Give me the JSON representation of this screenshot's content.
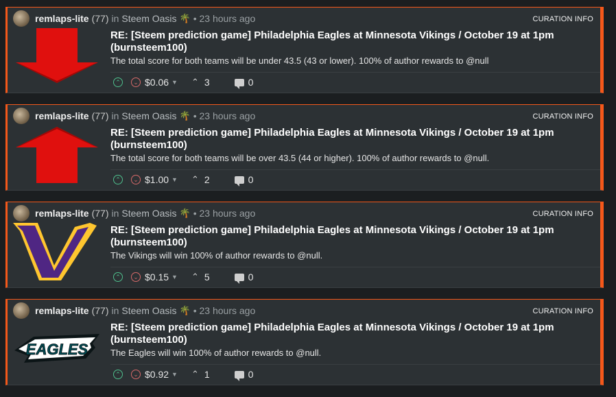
{
  "posts": [
    {
      "author": "remlaps-lite",
      "reputation": "(77)",
      "in_word": "in",
      "community": "Steem Oasis",
      "community_icon": "palm-tree-icon",
      "age": "• 23 hours ago",
      "curation_label": "CURATION INFO",
      "thumbnail": "red-down-arrow-thumbnail",
      "title": "RE: [Steem prediction game] Philadelphia Eagles at Minnesota Vikings / October 19 at 1pm (burnsteem100)",
      "body": "The total score for both teams will be under 43.5 (43 or lower). 100% of author rewards to @null",
      "payout": "$0.06",
      "voters": "3",
      "comments": "0"
    },
    {
      "author": "remlaps-lite",
      "reputation": "(77)",
      "in_word": "in",
      "community": "Steem Oasis",
      "community_icon": "palm-tree-icon",
      "age": "• 23 hours ago",
      "curation_label": "CURATION INFO",
      "thumbnail": "red-up-arrow-thumbnail",
      "title": "RE: [Steem prediction game] Philadelphia Eagles at Minnesota Vikings / October 19 at 1pm (burnsteem100)",
      "body": "The total score for both teams will be over 43.5 (44 or higher). 100% of author rewards to @null.",
      "payout": "$1.00",
      "voters": "2",
      "comments": "0"
    },
    {
      "author": "remlaps-lite",
      "reputation": "(77)",
      "in_word": "in",
      "community": "Steem Oasis",
      "community_icon": "palm-tree-icon",
      "age": "• 23 hours ago",
      "curation_label": "CURATION INFO",
      "thumbnail": "vikings-logo-thumbnail",
      "title": "RE: [Steem prediction game] Philadelphia Eagles at Minnesota Vikings / October 19 at 1pm (burnsteem100)",
      "body": "The Vikings will win 100% of author rewards to @null.",
      "payout": "$0.15",
      "voters": "5",
      "comments": "0"
    },
    {
      "author": "remlaps-lite",
      "reputation": "(77)",
      "in_word": "in",
      "community": "Steem Oasis",
      "community_icon": "palm-tree-icon",
      "age": "• 23 hours ago",
      "curation_label": "CURATION INFO",
      "thumbnail": "eagles-logo-thumbnail",
      "title": "RE: [Steem prediction game] Philadelphia Eagles at Minnesota Vikings / October 19 at 1pm (burnsteem100)",
      "body": "The Eagles will win 100% of author rewards to @null.",
      "payout": "$0.92",
      "voters": "1",
      "comments": "0"
    }
  ],
  "thumbnails": {
    "vikings_letter": "V",
    "eagles_wordmark": "EAGLES"
  },
  "colors": {
    "accent_border": "#f5581a",
    "card_bg": "#2c3134",
    "upvote": "#4fc08d",
    "downvote": "#d86a6a",
    "arrow_red": "#e0100e",
    "vikings_purple": "#4f2683",
    "vikings_gold": "#ffc62f"
  }
}
